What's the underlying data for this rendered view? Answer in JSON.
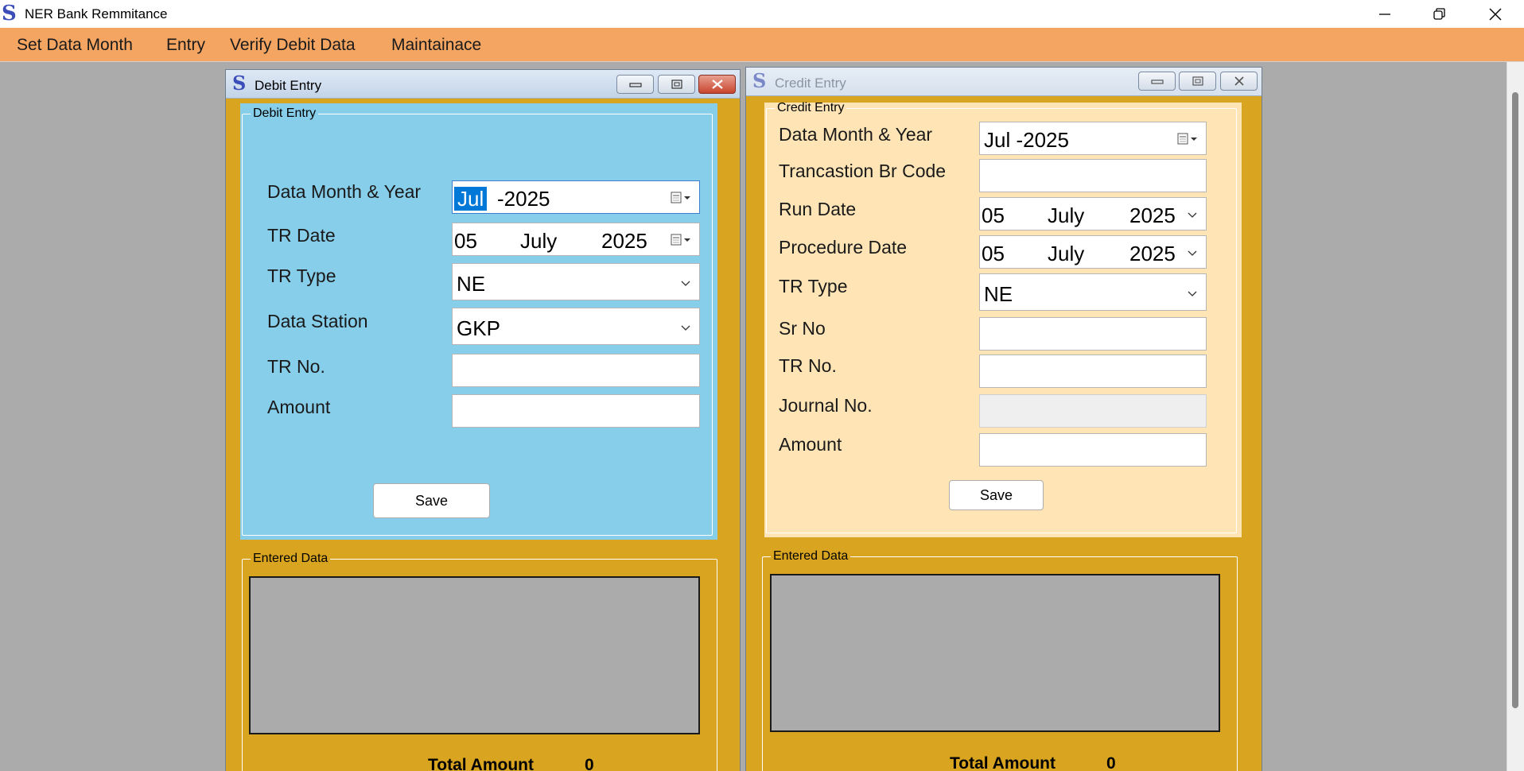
{
  "app": {
    "title": "NER Bank Remmitance"
  },
  "menu": [
    "Set Data Month",
    "Entry",
    "Verify Debit Data",
    "Maintainace"
  ],
  "debit": {
    "window_title": "Debit Entry",
    "group_label": "Debit  Entry",
    "labels": {
      "month_year": "Data Month & Year",
      "tr_date": "TR Date",
      "tr_type": "TR Type",
      "data_station": "Data Station",
      "tr_no": "TR No.",
      "amount": "Amount"
    },
    "values": {
      "month": "Jul",
      "year": "-2025",
      "tr_date_day": "05",
      "tr_date_month": "July",
      "tr_date_year": "2025",
      "tr_type": "NE",
      "data_station": "GKP",
      "tr_no": "",
      "amount": ""
    },
    "save_label": "Save",
    "entered_label": "Entered Data",
    "total_label": "Total Amount",
    "total_value": "0"
  },
  "credit": {
    "window_title": "Credit Entry",
    "group_label": "Credit Entry",
    "labels": {
      "month_year": "Data Month & Year",
      "br_code": "Trancastion Br Code",
      "run_date": "Run Date",
      "procedure_date": "Procedure Date",
      "tr_type": "TR Type",
      "sr_no": "Sr No",
      "tr_no": "TR No.",
      "journal_no": "Journal No.",
      "amount": "Amount"
    },
    "values": {
      "month_year": "Jul -2025",
      "br_code": "",
      "run_day": "05",
      "run_month": "July",
      "run_year": "2025",
      "proc_day": "05",
      "proc_month": "July",
      "proc_year": "2025",
      "tr_type": "NE",
      "sr_no": "",
      "tr_no": "",
      "journal_no": "",
      "amount": ""
    },
    "save_label": "Save",
    "entered_label": "Entered Data",
    "total_label": "Total Amount",
    "total_value": "0"
  },
  "colors": {
    "menu_bg": "#f5a562",
    "debit_panel": "#87ceeb",
    "credit_panel": "#ffe4b5",
    "window_bg": "#d9a521",
    "mdi_bg": "#ababab"
  }
}
